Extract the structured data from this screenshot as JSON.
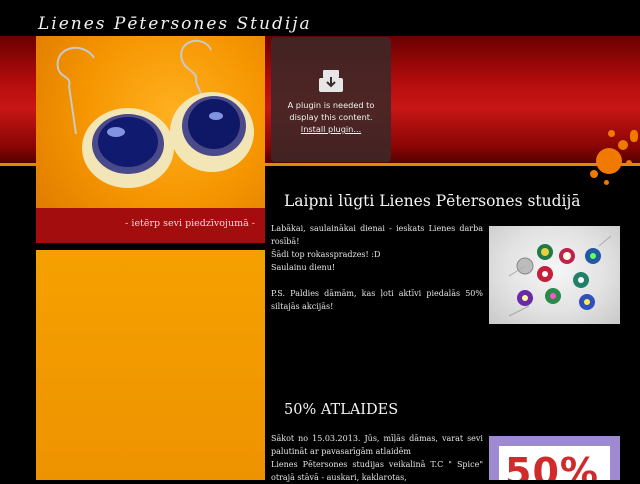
{
  "header": {
    "site_title": "Lienes Pētersones Studija",
    "slogan": "- ietērp sevi piedzīvojumā -"
  },
  "plugin": {
    "message": "A plugin is needed to display this content.",
    "install_link": "Install plugin..."
  },
  "welcome": {
    "heading": "Laipni lūgti Lienes Pētersones studijā",
    "lines": [
      "Labākai, saulainākai dienai - ieskats Lienes darba rosībā!",
      "Šādi top rokasspradzes! :D",
      "Saulainu dienu!",
      "",
      "P.S. Paldies dāmām, kas ļoti aktīvi piedalās 50% siltajās akcijās!"
    ]
  },
  "sale": {
    "heading": "50% ATLAIDES",
    "lines": [
      "Sākot no 15.03.2013. Jūs, mīļās dāmas, varat sevi palutināt ar pavasarīgām atlaidēm",
      "Lienes Pētersones studijas veikalinā T.C \" Spice\" otrajā stāvā - auskari, kaklarotas,"
    ],
    "badge_text": "50%"
  },
  "colors": {
    "accent_red": "#b30c0c",
    "accent_orange": "#f59500",
    "background": "#000000"
  },
  "icons": {
    "plugin": "download-arrow-icon"
  }
}
